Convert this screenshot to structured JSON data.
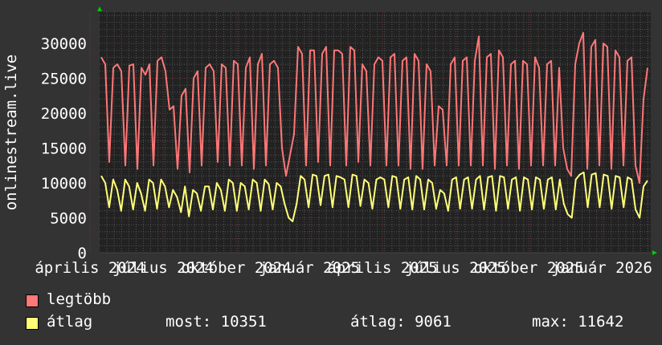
{
  "chart_data": {
    "type": "line",
    "ylabel": "onlinestream.live",
    "ylim": [
      0,
      34500
    ],
    "yticks": [
      "0",
      "5000",
      "10000",
      "15000",
      "20000",
      "25000",
      "30000"
    ],
    "ytick_values": [
      0,
      5000,
      10000,
      15000,
      20000,
      25000,
      30000
    ],
    "xticks": [
      "április 2024",
      "július 2024",
      "október 2024",
      "január 2025",
      "április 2025",
      "július 2025",
      "október 2025",
      "január 2026"
    ],
    "grid": true,
    "legend_placement": "bottom-left",
    "series": [
      {
        "name": "legtöbb",
        "color": "#ff7777",
        "values": [
          28000,
          27000,
          13000,
          26500,
          27000,
          26000,
          12500,
          26800,
          27000,
          12000,
          26500,
          25500,
          27000,
          12500,
          27500,
          28000,
          26000,
          20500,
          21000,
          12000,
          22500,
          23500,
          11500,
          25000,
          26000,
          12500,
          26500,
          27000,
          26000,
          13000,
          27000,
          26500,
          12500,
          27500,
          27000,
          12500,
          26500,
          28000,
          12000,
          27000,
          28500,
          12500,
          27000,
          27500,
          26500,
          15000,
          11000,
          14000,
          17000,
          29500,
          28500,
          12500,
          29000,
          29000,
          13000,
          28500,
          29500,
          12500,
          29000,
          29000,
          28500,
          12500,
          29500,
          29000,
          13000,
          27000,
          26000,
          12500,
          27000,
          28000,
          27500,
          12500,
          28000,
          28500,
          12500,
          27500,
          28000,
          12000,
          28500,
          27500,
          12000,
          27000,
          26000,
          12500,
          21000,
          20500,
          12500,
          27000,
          28000,
          12500,
          27500,
          28000,
          12500,
          27500,
          31000,
          12500,
          28000,
          28500,
          12000,
          29000,
          28000,
          12500,
          27000,
          27500,
          12000,
          27500,
          27000,
          12500,
          28000,
          26500,
          12500,
          27000,
          27500,
          12500,
          26500,
          15000,
          12000,
          11000,
          27000,
          30000,
          31500,
          12000,
          29500,
          30500,
          12500,
          30000,
          29500,
          12000,
          29000,
          28000,
          12500,
          27500,
          28000,
          12500,
          10000,
          22000,
          26500
        ]
      },
      {
        "name": "átlag",
        "color": "#ffff77",
        "values": [
          11000,
          10000,
          6500,
          10500,
          9000,
          6000,
          10500,
          9500,
          6200,
          10000,
          8500,
          6000,
          10500,
          10000,
          6300,
          10500,
          9500,
          6500,
          9000,
          8000,
          5800,
          9500,
          5200,
          9000,
          8500,
          6000,
          9500,
          9500,
          6200,
          10000,
          9000,
          6000,
          10500,
          10000,
          6000,
          10000,
          9500,
          6200,
          10500,
          10000,
          6000,
          10500,
          9800,
          6200,
          10000,
          9500,
          7000,
          5000,
          4500,
          7000,
          11000,
          10500,
          6500,
          11200,
          11000,
          6800,
          11000,
          11200,
          6500,
          11000,
          10800,
          10500,
          6500,
          11200,
          11000,
          6700,
          10500,
          10000,
          6300,
          10500,
          10800,
          10500,
          6500,
          11000,
          10800,
          6300,
          10500,
          10800,
          6200,
          11000,
          10500,
          6200,
          10500,
          10000,
          6300,
          9000,
          8500,
          6000,
          10500,
          10800,
          6300,
          10500,
          10800,
          6300,
          10500,
          11000,
          6200,
          10800,
          11000,
          6000,
          11000,
          10800,
          6300,
          10500,
          10800,
          6000,
          10800,
          10500,
          6200,
          10800,
          10500,
          6300,
          10500,
          10800,
          6200,
          10500,
          7000,
          5500,
          5000,
          10500,
          11200,
          11500,
          6500,
          11200,
          11400,
          6500,
          11200,
          11000,
          6300,
          11000,
          10800,
          6500,
          10800,
          10500,
          6200,
          5000,
          9500,
          10351
        ]
      }
    ]
  },
  "legend": {
    "items": [
      {
        "label": "legtöbb",
        "color": "#ff7777"
      },
      {
        "label": "átlag",
        "color": "#ffff77"
      }
    ],
    "stats": {
      "now": "most: 10351",
      "avg": "átlag: 9061",
      "max": "max: 11642"
    }
  }
}
